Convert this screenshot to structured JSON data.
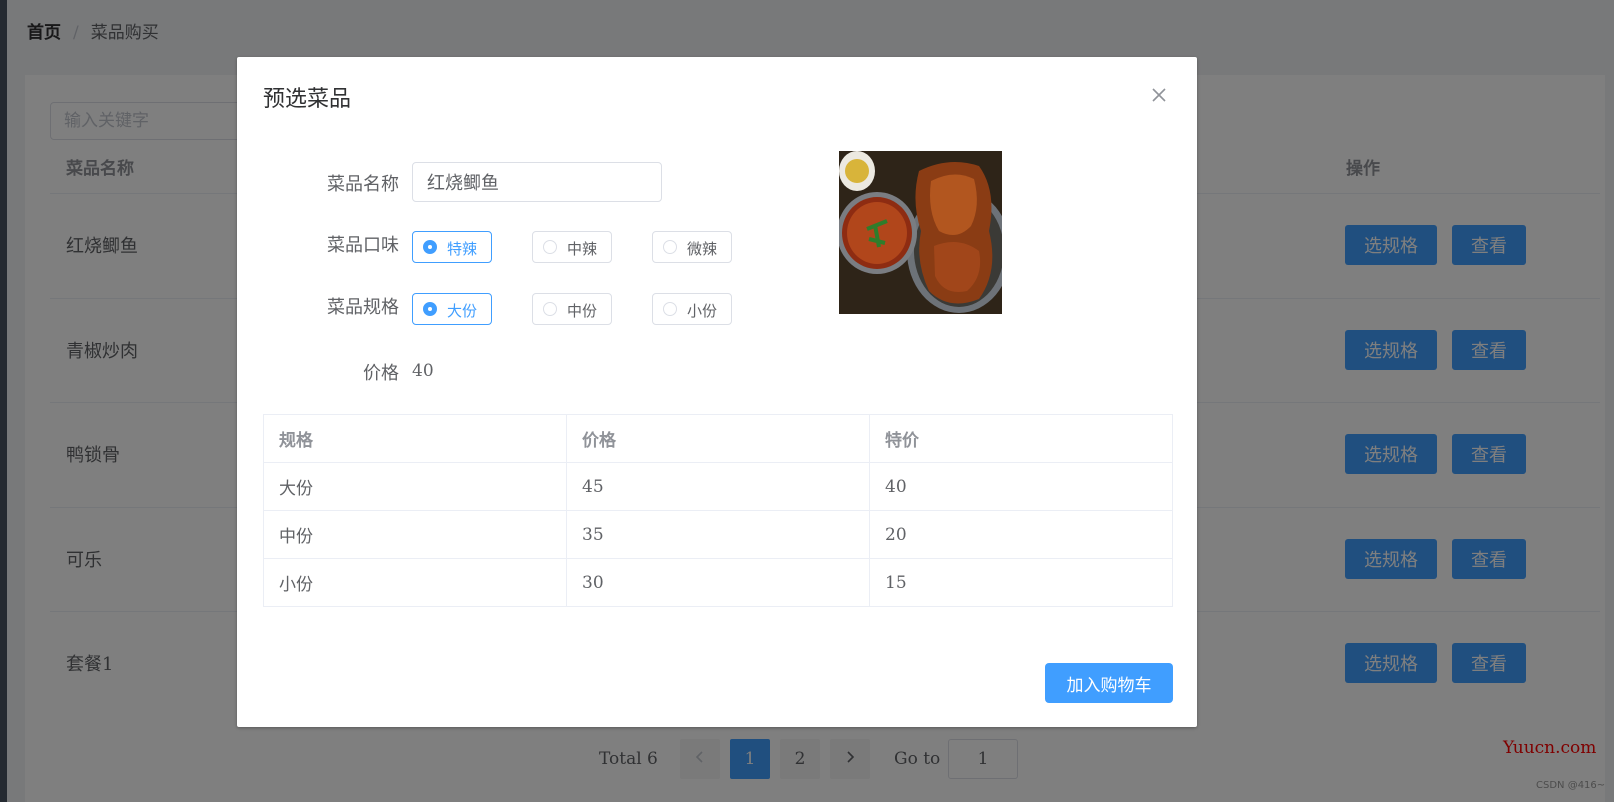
{
  "breadcrumb": {
    "home": "首页",
    "separator": "/",
    "current": "菜品购买"
  },
  "search": {
    "placeholder": "输入关键字",
    "value": ""
  },
  "table": {
    "columns": [
      "菜品名称",
      "操作"
    ],
    "rows": [
      {
        "name": "红烧鲫鱼"
      },
      {
        "name": "青椒炒肉"
      },
      {
        "name": "鸭锁骨"
      },
      {
        "name": "可乐"
      },
      {
        "name": "套餐1"
      }
    ],
    "actions": {
      "spec": "选规格",
      "view": "查看"
    }
  },
  "pagination": {
    "total_label": "Total 6",
    "prev_icon": "chevron-left-icon",
    "pages": [
      "1",
      "2"
    ],
    "current_page": "1",
    "next_icon": "chevron-right-icon",
    "goto_label": "Go to",
    "goto_value": "1"
  },
  "watermark": "Yuucn.com",
  "csdn_credit": "CSDN @416~",
  "dialog": {
    "title": "预选菜品",
    "close_icon": "close-icon",
    "fields": {
      "name_label": "菜品名称",
      "name_value": "红烧鲫鱼",
      "taste_label": "菜品口味",
      "taste_options": [
        "特辣",
        "中辣",
        "微辣"
      ],
      "taste_selected": "特辣",
      "size_label": "菜品规格",
      "size_options": [
        "大份",
        "中份",
        "小份"
      ],
      "size_selected": "大份",
      "price_label": "价格",
      "price_value": "40"
    },
    "image": "dish-photo",
    "spec_table": {
      "headers": [
        "规格",
        "价格",
        "特价"
      ],
      "rows": [
        [
          "大份",
          "45",
          "40"
        ],
        [
          "中份",
          "35",
          "20"
        ],
        [
          "小份",
          "30",
          "15"
        ]
      ]
    },
    "add_to_cart": "加入购物车"
  },
  "colors": {
    "primary": "#409eff",
    "overlay": "rgba(0,0,0,0.5)",
    "watermark": "#ff0000"
  }
}
